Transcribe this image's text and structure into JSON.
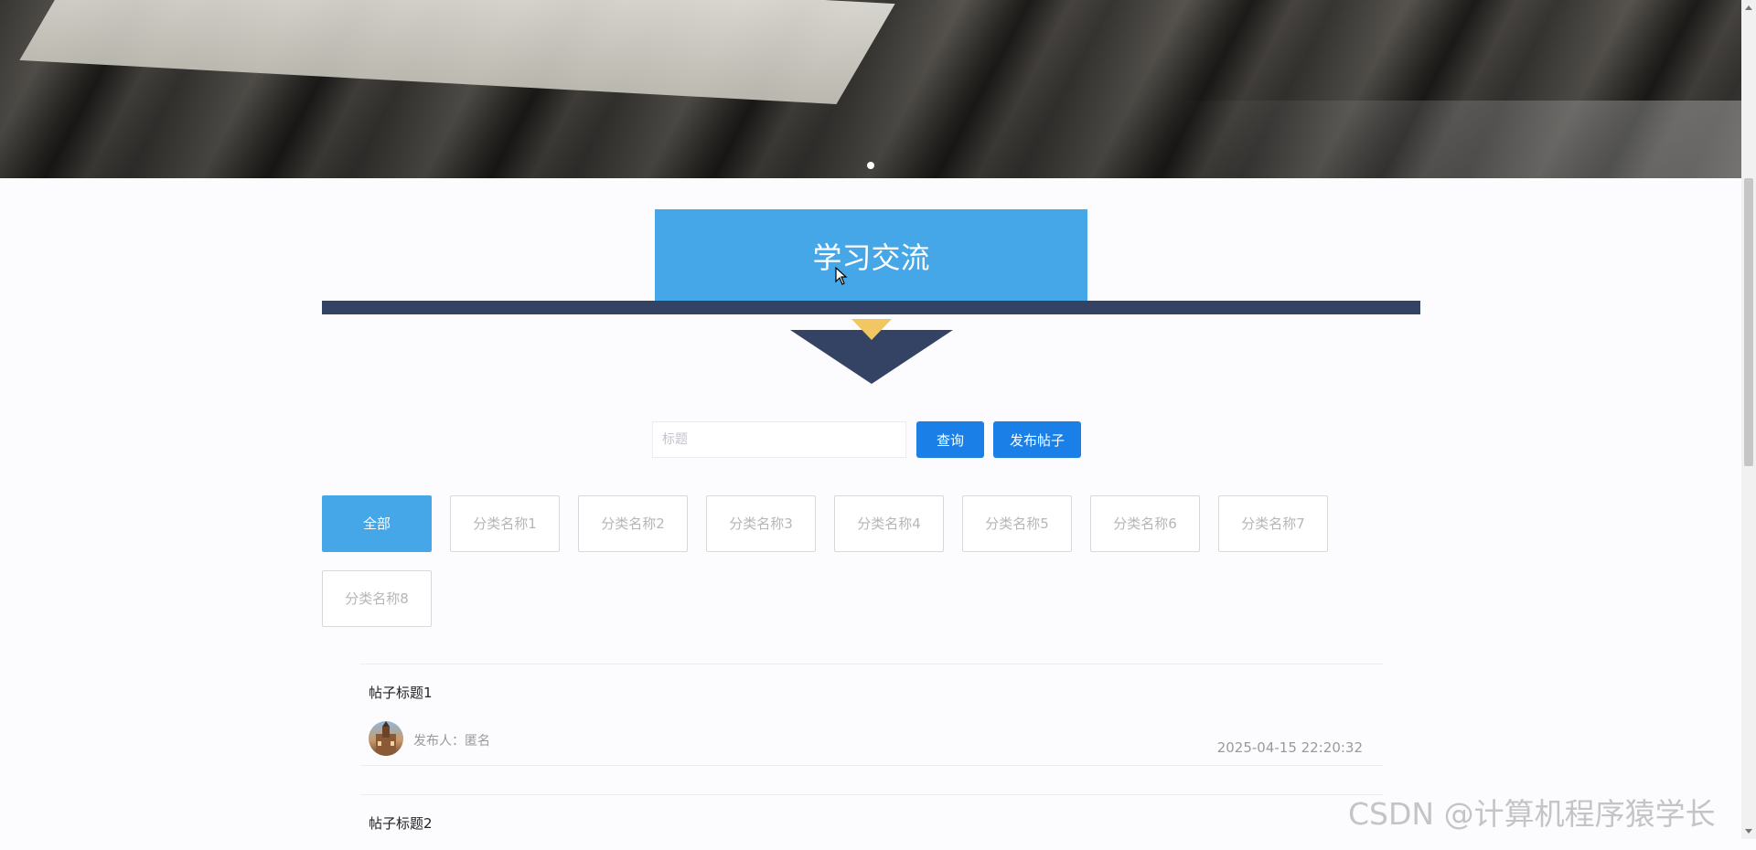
{
  "section": {
    "title": "学习交流"
  },
  "search": {
    "placeholder": "标题",
    "value": ""
  },
  "buttons": {
    "query_label": "查询",
    "publish_label": "发布帖子"
  },
  "categories": [
    {
      "label": "全部",
      "active": true
    },
    {
      "label": "分类名称1",
      "active": false
    },
    {
      "label": "分类名称2",
      "active": false
    },
    {
      "label": "分类名称3",
      "active": false
    },
    {
      "label": "分类名称4",
      "active": false
    },
    {
      "label": "分类名称5",
      "active": false
    },
    {
      "label": "分类名称6",
      "active": false
    },
    {
      "label": "分类名称7",
      "active": false
    },
    {
      "label": "分类名称8",
      "active": false
    }
  ],
  "posts": [
    {
      "title": "帖子标题1",
      "author_label": "发布人：",
      "author": "匿名",
      "time": "2025-04-15 22:20:32"
    },
    {
      "title": "帖子标题2"
    }
  ],
  "watermark": "CSDN @计算机程序猿学长",
  "colors": {
    "title_bg": "#46a7e8",
    "bar": "#344263",
    "accent": "#f1c762",
    "button": "#1a7fe7"
  }
}
